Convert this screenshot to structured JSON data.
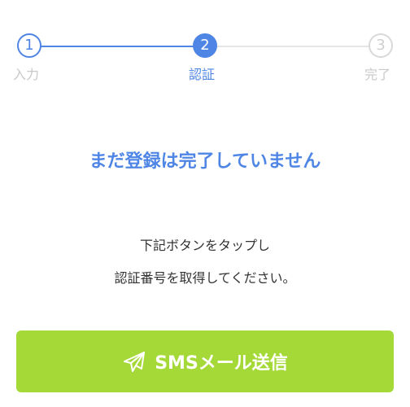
{
  "stepper": {
    "steps": [
      {
        "number": "1",
        "label": "入力"
      },
      {
        "number": "2",
        "label": "認証"
      },
      {
        "number": "3",
        "label": "完了"
      }
    ]
  },
  "main": {
    "headline": "まだ登録は完了していません",
    "instructions": [
      "下記ボタンをタップし",
      "認証番号を取得してください。"
    ]
  },
  "action": {
    "sms_button_label": "SMSメール送信",
    "icon": "paper-plane-icon"
  },
  "colors": {
    "accent": "#4f86e6",
    "button": "#a5d937",
    "inactive": "#c9c9c9"
  }
}
